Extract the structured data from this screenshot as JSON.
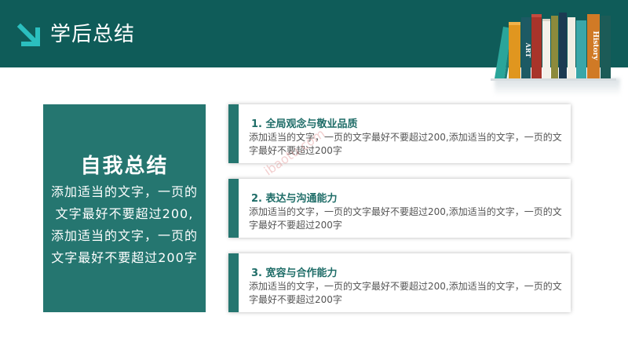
{
  "header": {
    "title": "学后总结"
  },
  "books": {
    "labels": [
      "ART",
      "History"
    ]
  },
  "left_panel": {
    "title": "自我总结",
    "body": "添加适当的文字，一页的文字最好不要超过200,添加适当的文字，一页的文字最好不要超过200字"
  },
  "cards": [
    {
      "heading": "1. 全局观念与敬业品质",
      "text": "添加适当的文字，一页的文字最好不要超过200,添加适当的文字，一页的文字最好不要超过200字"
    },
    {
      "heading": "2. 表达与沟通能力",
      "text": "添加适当的文字，一页的文字最好不要超过200,添加适当的文字，一页的文字最好不要超过200字"
    },
    {
      "heading": "3. 宽容与合作能力",
      "text": "添加适当的文字，一页的文字最好不要超过200,添加适当的文字，一页的文字最好不要超过200字"
    }
  ],
  "watermark": {
    "text": "ibaotu.com"
  },
  "colors": {
    "header": "#0f5c59",
    "accent": "#257670",
    "arrow": "#2bbfbf"
  }
}
